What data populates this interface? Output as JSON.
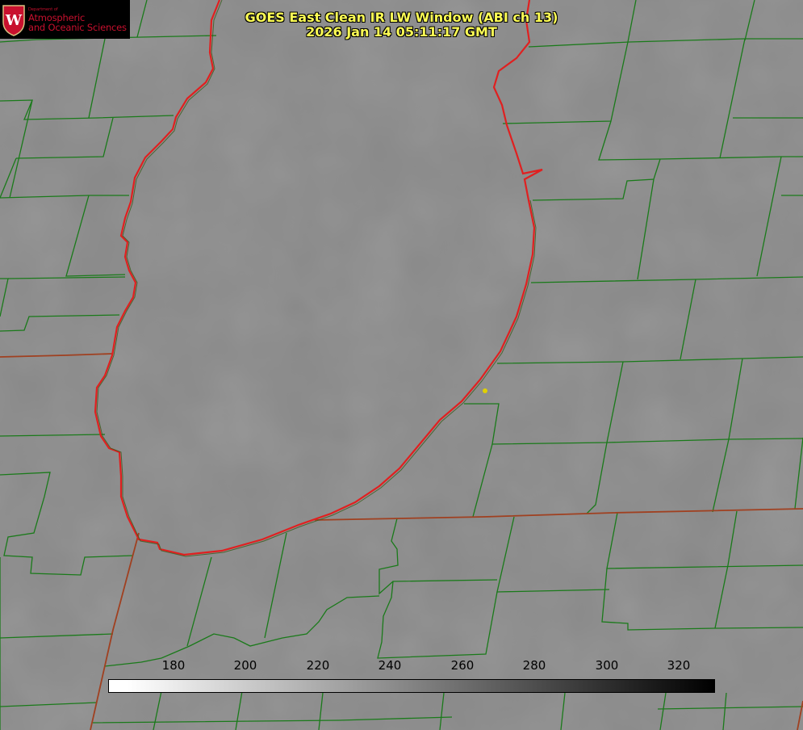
{
  "logo": {
    "dept_line": "Department of",
    "line1": "Atmospheric",
    "line2": "and Oceanic Sciences",
    "brand_color": "#c8102e",
    "seal_letter": "W"
  },
  "title": {
    "line1": "GOES East Clean IR LW Window (ABI ch 13)",
    "line2": "2026 Jan 14 05:11:17 GMT",
    "color": "#ffff55"
  },
  "colorbar": {
    "ticks": [
      "180",
      "200",
      "220",
      "240",
      "260",
      "280",
      "300",
      "320"
    ],
    "range": [
      162,
      330
    ],
    "gradient": "white-to-black"
  },
  "map": {
    "background": "#8a8a8a",
    "county_line_color": "#1a7a1a",
    "state_line_color": "#a04020",
    "coastline_color": "#e02020",
    "marker_color": "#e0d000"
  }
}
